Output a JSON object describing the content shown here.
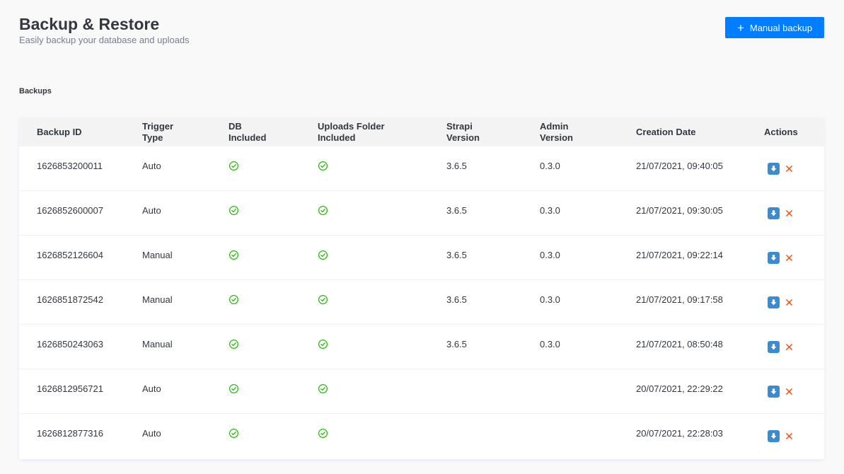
{
  "header": {
    "title": "Backup & Restore",
    "subtitle": "Easily backup your database and uploads",
    "manual_backup_label": "Manual backup"
  },
  "section_label": "Backups",
  "table": {
    "columns": [
      {
        "key": "id",
        "label": "Backup ID"
      },
      {
        "key": "trigger",
        "label": "Trigger Type"
      },
      {
        "key": "db",
        "label": "DB Included"
      },
      {
        "key": "uploads",
        "label": "Uploads Folder Included"
      },
      {
        "key": "strapi",
        "label": "Strapi Version"
      },
      {
        "key": "admin",
        "label": "Admin Version"
      },
      {
        "key": "created",
        "label": "Creation Date"
      },
      {
        "key": "actions",
        "label": "Actions"
      }
    ],
    "rows": [
      {
        "id": "1626853200011",
        "trigger": "Auto",
        "db": true,
        "uploads": true,
        "strapi": "3.6.5",
        "admin": "0.3.0",
        "created": "21/07/2021, 09:40:05"
      },
      {
        "id": "1626852600007",
        "trigger": "Auto",
        "db": true,
        "uploads": true,
        "strapi": "3.6.5",
        "admin": "0.3.0",
        "created": "21/07/2021, 09:30:05"
      },
      {
        "id": "1626852126604",
        "trigger": "Manual",
        "db": true,
        "uploads": true,
        "strapi": "3.6.5",
        "admin": "0.3.0",
        "created": "21/07/2021, 09:22:14"
      },
      {
        "id": "1626851872542",
        "trigger": "Manual",
        "db": true,
        "uploads": true,
        "strapi": "3.6.5",
        "admin": "0.3.0",
        "created": "21/07/2021, 09:17:58"
      },
      {
        "id": "1626850243063",
        "trigger": "Manual",
        "db": true,
        "uploads": true,
        "strapi": "3.6.5",
        "admin": "0.3.0",
        "created": "21/07/2021, 08:50:48"
      },
      {
        "id": "1626812956721",
        "trigger": "Auto",
        "db": true,
        "uploads": true,
        "strapi": "",
        "admin": "",
        "created": "20/07/2021, 22:29:22"
      },
      {
        "id": "1626812877316",
        "trigger": "Auto",
        "db": true,
        "uploads": true,
        "strapi": "",
        "admin": "",
        "created": "20/07/2021, 22:28:03"
      }
    ]
  },
  "icons": {
    "plus": "plus-icon",
    "check": "check-circle-icon",
    "download": "download-icon",
    "delete": "close-icon"
  },
  "colors": {
    "accent": "#007eff",
    "check": "#27b70a",
    "delete": "#f64d0a",
    "download": "#3a8bd1"
  }
}
